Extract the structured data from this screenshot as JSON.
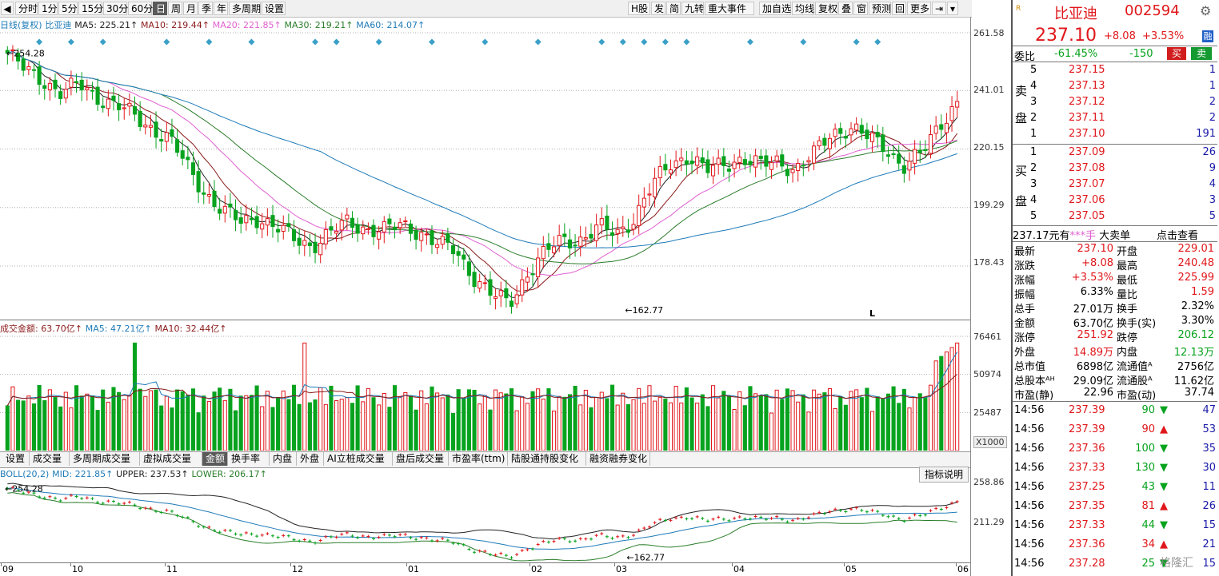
{
  "toolbar": {
    "periods": [
      "分时",
      "1分",
      "5分",
      "15分",
      "30分",
      "60分",
      "日",
      "周",
      "月",
      "季",
      "年",
      "多周期",
      "设置"
    ],
    "selected_period": "日",
    "tools": [
      "H股",
      "发",
      "简",
      "九转",
      "重大事件",
      "加自选",
      "均线",
      "复权",
      "叠",
      "窗",
      "预测",
      "回",
      "更多"
    ]
  },
  "ma_legend": {
    "prefix": "日线(复权)",
    "stock": "比亚迪",
    "ma5": "MA5: 225.21↑",
    "ma10": "MA10: 219.44↑",
    "ma20": "MA20: 221.85↑",
    "ma30": "MA30: 219.21↑",
    "ma60": "MA60: 214.07↑"
  },
  "price_axis": [
    "261.58",
    "241.01",
    "220.15",
    "199.29",
    "178.43"
  ],
  "price_annotations": {
    "high": "254.28",
    "low": "162.77",
    "marker": "L"
  },
  "volume_legend": {
    "amount": "成交金额: 63.70亿↑",
    "ma5": "MA5: 47.21亿↑",
    "ma10": "MA10: 32.44亿↑"
  },
  "volume_axis": [
    "76461",
    "50974",
    "25487"
  ],
  "volume_unit": "X1000",
  "indicator_tabs": [
    "设置",
    "成交量",
    "多周期成交量",
    "虚拟成交量",
    "金额",
    "换手率",
    "内盘",
    "外盘",
    "AI立桩成交量",
    "盘后成交量",
    "市盈率(ttm)",
    "陆股通持股变化",
    "融资融券变化"
  ],
  "selected_indicator_tab": "金额",
  "boll_legend": {
    "label": "BOLL(20,2)",
    "mid": "MID: 221.85↑",
    "upper": "UPPER: 237.53↑",
    "lower": "LOWER: 206.17↑"
  },
  "boll_help": "指标说明",
  "boll_axis": [
    "258.86",
    "211.29"
  ],
  "boll_annotations": {
    "high": "254.28",
    "low": "162.77"
  },
  "x_axis": [
    "09",
    "10",
    "11",
    "12",
    "01",
    "02",
    "03",
    "04",
    "05",
    "06"
  ],
  "colors": {
    "up": "#e0171b",
    "down": "#07a31e",
    "ma5": "#222222",
    "ma10": "#8b1a1a",
    "ma20": "#e05fd0",
    "ma30": "#2a7d2a",
    "ma60": "#1f7bb8"
  },
  "quote": {
    "name": "比亚迪",
    "code": "002594",
    "price": "237.10",
    "change": "+8.08",
    "change_pct": "+3.53%",
    "exchange_tag": "融",
    "weibi_label": "委比",
    "weibi": "-61.45%",
    "weicha": "-150",
    "buy_btn": "买",
    "sell_btn": "卖"
  },
  "ask_label": [
    "卖",
    "盘"
  ],
  "bid_label": [
    "买",
    "盘"
  ],
  "asks": [
    {
      "level": "5",
      "price": "237.15",
      "vol": "1"
    },
    {
      "level": "4",
      "price": "237.13",
      "vol": "1"
    },
    {
      "level": "3",
      "price": "237.12",
      "vol": "2"
    },
    {
      "level": "2",
      "price": "237.11",
      "vol": "2"
    },
    {
      "level": "1",
      "price": "237.10",
      "vol": "191"
    }
  ],
  "bids": [
    {
      "level": "1",
      "price": "237.09",
      "vol": "26"
    },
    {
      "level": "2",
      "price": "237.08",
      "vol": "9"
    },
    {
      "level": "3",
      "price": "237.07",
      "vol": "4"
    },
    {
      "level": "4",
      "price": "237.06",
      "vol": "3"
    },
    {
      "level": "5",
      "price": "237.05",
      "vol": "5"
    }
  ],
  "bigorder_bar": {
    "text1": "237.17元有",
    "text2": "***手",
    "text3": "大卖单",
    "link": "点击查看"
  },
  "stats": [
    {
      "l1": "最新",
      "v1": "237.10",
      "l2": "开盘",
      "v2": "229.01"
    },
    {
      "l1": "涨跌",
      "v1": "+8.08",
      "l2": "最高",
      "v2": "240.48"
    },
    {
      "l1": "涨幅",
      "v1": "+3.53%",
      "l2": "最低",
      "v2": "225.99"
    },
    {
      "l1": "振幅",
      "v1": "6.33%",
      "l2": "量比",
      "v2": "1.59"
    },
    {
      "l1": "总手",
      "v1": "27.01万",
      "l2": "换手",
      "v2": "2.32%"
    },
    {
      "l1": "金额",
      "v1": "63.70亿",
      "l2": "换手(实)",
      "v2": "3.30%"
    },
    {
      "l1": "涨停",
      "v1": "251.92",
      "l2": "跌停",
      "v2": "206.12"
    },
    {
      "l1": "外盘",
      "v1": "14.89万",
      "l2": "内盘",
      "v2": "12.13万"
    },
    {
      "l1": "总市值",
      "v1": "6898亿",
      "l2": "流通值ᴬ",
      "v2": "2756亿"
    },
    {
      "l1": "总股本ᴬᴴ",
      "v1": "29.09亿",
      "l2": "流通股ᴬ",
      "v2": "11.62亿"
    },
    {
      "l1": "市盈(静)",
      "v1": "22.96",
      "l2": "市盈(动)",
      "v2": "37.74"
    }
  ],
  "ticks": [
    {
      "time": "14:56",
      "price": "237.39",
      "vol": "90",
      "dir": "down",
      "n": "47"
    },
    {
      "time": "14:56",
      "price": "237.39",
      "vol": "90",
      "dir": "up",
      "n": "53"
    },
    {
      "time": "14:56",
      "price": "237.36",
      "vol": "100",
      "dir": "down",
      "n": "35"
    },
    {
      "time": "14:56",
      "price": "237.33",
      "vol": "130",
      "dir": "down",
      "n": "30"
    },
    {
      "time": "14:56",
      "price": "237.25",
      "vol": "43",
      "dir": "down",
      "n": "11"
    },
    {
      "time": "14:56",
      "price": "237.35",
      "vol": "81",
      "dir": "up",
      "n": "26"
    },
    {
      "time": "14:56",
      "price": "237.33",
      "vol": "44",
      "dir": "down",
      "n": "15"
    },
    {
      "time": "14:56",
      "price": "237.36",
      "vol": "34",
      "dir": "up",
      "n": "21"
    },
    {
      "time": "14:56",
      "price": "237.28",
      "vol": "25",
      "dir": "down",
      "n": "15"
    }
  ],
  "watermark": "格隆汇",
  "chart_data": {
    "type": "candlestick",
    "x_labels": [
      "09",
      "10",
      "11",
      "12",
      "01",
      "02",
      "03",
      "04",
      "05",
      "06"
    ],
    "ylim": [
      162.77,
      261.58
    ],
    "high_label": 254.28,
    "low_label": 162.77,
    "last_close": 237.1,
    "anchors": [
      254.28,
      248,
      245,
      240,
      243,
      239,
      236,
      232,
      228,
      224,
      214,
      205,
      198,
      194,
      196,
      192,
      188,
      186,
      190,
      194,
      192,
      191,
      193,
      191,
      186,
      184,
      175,
      168,
      165,
      176,
      183,
      188,
      188,
      192,
      190,
      196,
      207,
      215,
      218,
      212,
      215,
      217,
      214,
      216,
      213,
      218,
      226,
      228,
      224,
      221,
      214,
      218,
      229,
      237.1
    ],
    "volume_ylim": [
      0,
      76461
    ]
  }
}
